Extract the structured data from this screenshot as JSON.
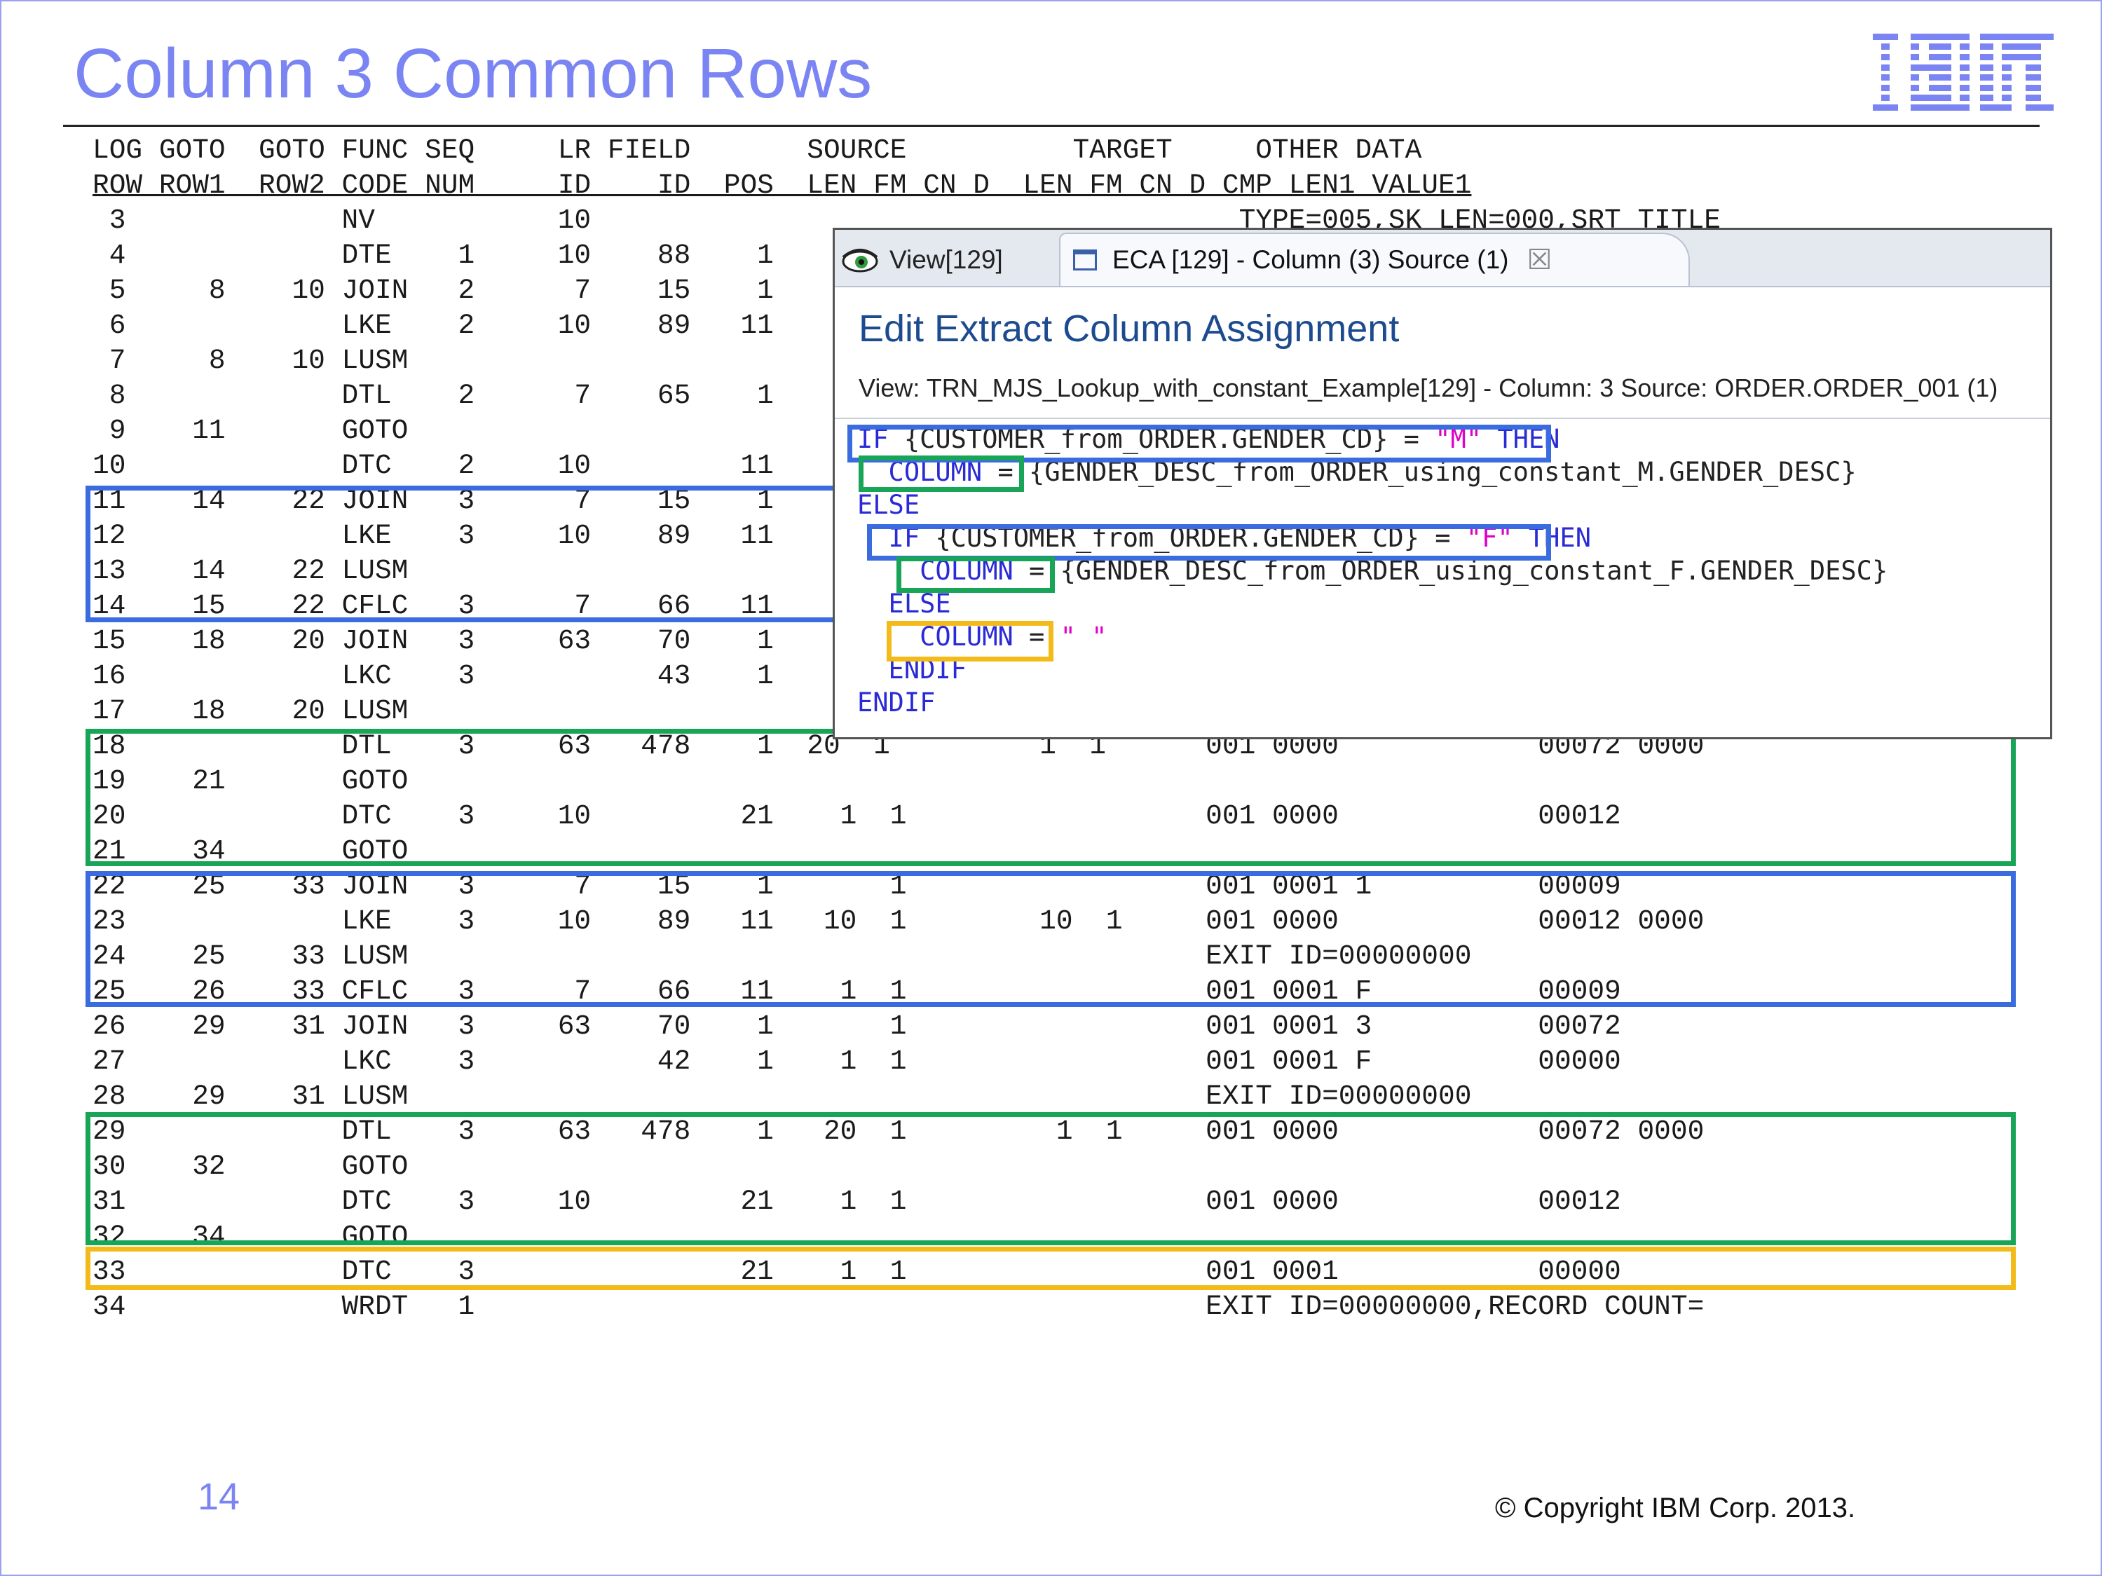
{
  "slide": {
    "title": "Column 3 Common Rows",
    "page_number": "14",
    "copyright": "© Copyright IBM Corp. 2013.",
    "logo_text": "IBM",
    "title_color": "#7a84f2"
  },
  "table": {
    "header1": "LOG GOTO  GOTO FUNC SEQ     LR FIELD       SOURCE          TARGET     OTHER DATA",
    "header2": "ROW ROW1  ROW2 CODE NUM     ID    ID  POS  LEN FM CN D  LEN FM CN D CMP LEN1 VALUE1",
    "rows": [
      " 3             NV           10                                       TYPE=005,SK LEN=000,SRT TITLE",
      " 4             DTE    1     10    88    1",
      " 5     8    10 JOIN   2      7    15    1",
      " 6             LKE    2     10    89   11",
      " 7     8    10 LUSM",
      " 8             DTL    2      7    65    1",
      " 9    11       GOTO",
      "10             DTC    2     10         11",
      "11    14    22 JOIN   3      7    15    1",
      "12             LKE    3     10    89   11",
      "13    14    22 LUSM",
      "14    15    22 CFLC   3      7    66   11",
      "15    18    20 JOIN   3     63    70    1",
      "16             LKC    3           43    1",
      "17    18    20 LUSM",
      "18             DTL    3     63   478    1  20  1         1  1      001 0000            00072 0000",
      "19    21       GOTO",
      "20             DTC    3     10         21    1  1                  001 0000            00012",
      "21    34       GOTO",
      "22    25    33 JOIN   3      7    15    1       1                  001 0001 1          00009",
      "23             LKE    3     10    89   11   10  1        10  1     001 0000            00012 0000",
      "24    25    33 LUSM                                                EXIT ID=00000000",
      "25    26    33 CFLC   3      7    66   11    1  1                  001 0001 F          00009",
      "26    29    31 JOIN   3     63    70    1       1                  001 0001 3          00072",
      "27             LKC    3           42    1    1  1                  001 0001 F          00000",
      "28    29    31 LUSM                                                EXIT ID=00000000",
      "29             DTL    3     63   478    1   20  1         1  1     001 0000            00072 0000",
      "30    32       GOTO",
      "31             DTC    3     10         21    1  1                  001 0000            00012",
      "32    34       GOTO",
      "33             DTC    3                21    1  1                  001 0001            00000",
      "34             WRDT   1                                            EXIT ID=00000000,RECORD COUNT="
    ]
  },
  "popup": {
    "tab_view": "View[129]",
    "tab_eca": "ECA [129] - Column (3) Source (1)",
    "close_glyph": "☒",
    "heading": "Edit Extract Column Assignment",
    "subtitle": "View: TRN_MJS_Lookup_with_constant_Example[129] - Column: 3 Source: ORDER.ORDER_001 (1)",
    "lines": {
      "l1_kw": "IF ",
      "l1_text": "{CUSTOMER_from_ORDER.GENDER_CD} = ",
      "l1_str": "\"M\"",
      "l1_then": " THEN",
      "l2_kw": "  COLUMN",
      "l2_text": " = {GENDER_DESC_from_ORDER_using_constant_M.GENDER_DESC}",
      "l3_kw": "ELSE",
      "l4_kw": "  IF ",
      "l4_text": "{CUSTOMER_from_ORDER.GENDER_CD} = ",
      "l4_str": "\"F\"",
      "l4_then": " THEN",
      "l5_kw": "    COLUMN",
      "l5_text": " = {GENDER_DESC_from_ORDER_using_constant_F.GENDER_DESC}",
      "l6_kw": "  ELSE",
      "l7_kw": "    COLUMN",
      "l7_text": " = ",
      "l7_str": "\" \"",
      "l8_kw": "  ENDIF",
      "l9_kw": "ENDIF"
    }
  },
  "highlight_colors": {
    "blue": "#3a6ce0",
    "green": "#18a558",
    "yellow": "#f2bb1a"
  }
}
